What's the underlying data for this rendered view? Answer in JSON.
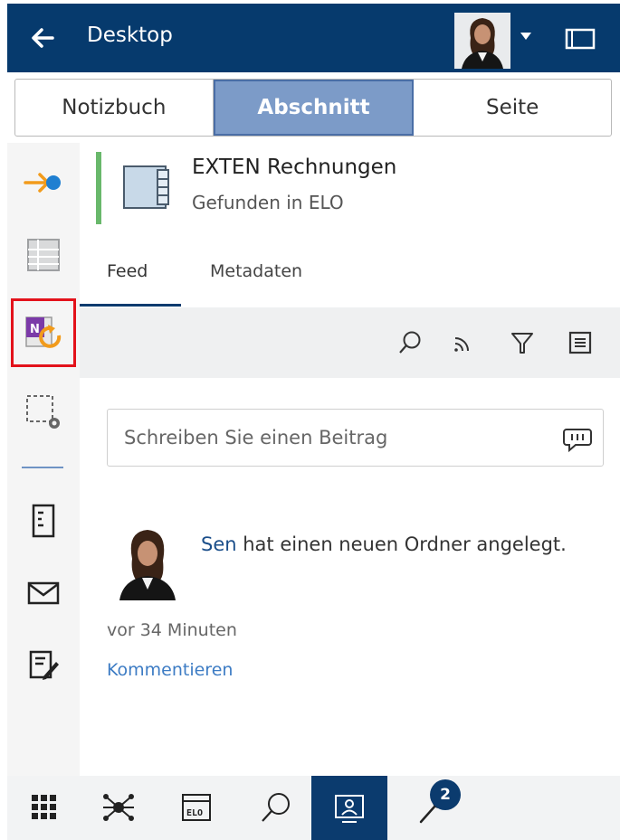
{
  "header": {
    "title": "Desktop",
    "back_icon": "arrow-left-icon",
    "window_icon": "window-icon"
  },
  "segments": {
    "items": [
      "Notizbuch",
      "Abschnitt",
      "Seite"
    ],
    "active": "Abschnitt"
  },
  "left_rail": {
    "items": [
      {
        "icon": "login-arrow-icon",
        "highlighted": false
      },
      {
        "icon": "list-view-icon",
        "highlighted": false
      },
      {
        "icon": "onenote-sync-icon",
        "highlighted": true
      },
      {
        "icon": "selection-settings-icon",
        "highlighted": false
      },
      {
        "icon": "document-icon",
        "highlighted": false
      },
      {
        "icon": "mail-icon",
        "highlighted": false
      },
      {
        "icon": "edit-note-icon",
        "highlighted": false
      }
    ]
  },
  "document": {
    "title": "EXTEN Rechnungen",
    "subtitle": "Gefunden in ELO",
    "icon": "folder-register-icon"
  },
  "tabs": {
    "feed": "Feed",
    "metadata": "Metadaten",
    "active": "Feed"
  },
  "toolbar": {
    "icons": [
      "search-icon",
      "rss-icon",
      "filter-icon",
      "menu-icon"
    ]
  },
  "post_input": {
    "placeholder": "Schreiben Sie einen Beitrag",
    "value": ""
  },
  "feed": {
    "user": "Sen",
    "action": "hat einen neuen Ordner angelegt.",
    "time": "vor 34 Minuten",
    "comment_link": "Kommentieren"
  },
  "bottom_bar": {
    "items": [
      {
        "icon": "apps-grid-icon"
      },
      {
        "icon": "network-icon"
      },
      {
        "icon": "elo-icon",
        "label": "ELO"
      },
      {
        "icon": "search-icon"
      },
      {
        "icon": "desktop-user-icon",
        "active": true
      },
      {
        "icon": "pin-icon",
        "badge": "2"
      }
    ]
  },
  "colors": {
    "primary": "#063a6d",
    "segment_active": "#7c9bc8",
    "highlight": "#e3121b",
    "accent_green": "#69b86b",
    "link": "#3d7cc4"
  }
}
